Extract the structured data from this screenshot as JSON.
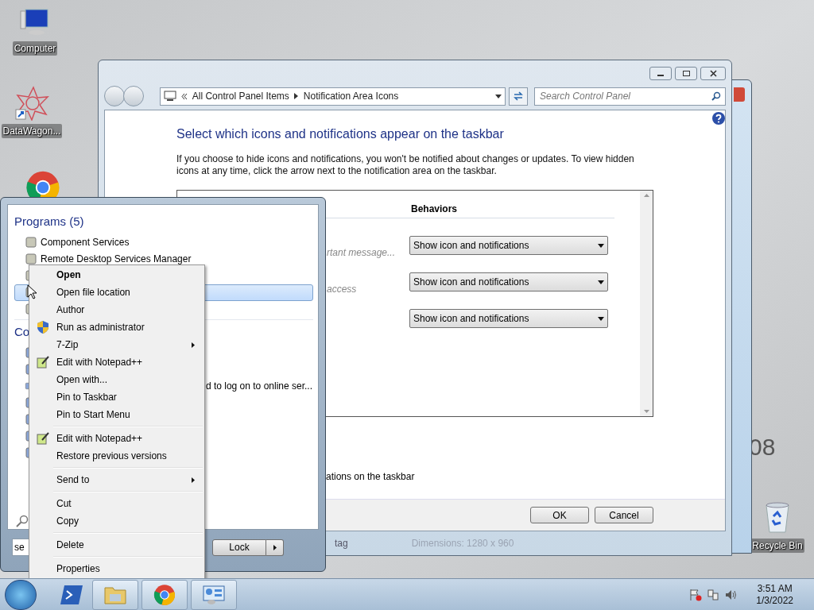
{
  "desktop": {
    "icons": [
      {
        "label": "Computer",
        "kind": "computer"
      },
      {
        "label": "DataWagon...",
        "kind": "shortcut"
      },
      {
        "kind": "browser"
      },
      {
        "label": "Recycle Bin",
        "kind": "recycle"
      }
    ],
    "wallpaper_text": "08"
  },
  "background_window": {
    "texts": [
      "tag",
      "Dimensions: 1280 x 960"
    ]
  },
  "control_panel": {
    "breadcrumb": [
      "All Control Panel Items",
      "Notification Area Icons"
    ],
    "search": {
      "placeholder": "Search Control Panel"
    },
    "heading": "Select which icons and notifications appear on the taskbar",
    "description": "If you choose to hide icons and notifications, you won't be notified about changes or updates. To view hidden icons at any time, click the arrow next to the notification area on the taskbar.",
    "table": {
      "columns": [
        "Behaviors"
      ],
      "rows": [
        {
          "description": "rtant message...",
          "behavior": "Show icon and notifications"
        },
        {
          "description": "access",
          "behavior": "Show icon and notifications"
        },
        {
          "behavior": "Show icon and notifications"
        }
      ]
    },
    "footer_text": "ations on the taskbar",
    "buttons": [
      "OK",
      "Cancel"
    ]
  },
  "start_menu": {
    "sections": [
      {
        "title": "Programs (5)",
        "items": [
          {
            "label": "Component Services",
            "selected": false
          },
          {
            "label": "Remote Desktop Services Manager",
            "selected": false
          },
          {
            "selected": false
          },
          {
            "selected": true
          },
          {
            "selected": false
          }
        ]
      },
      {
        "title": "Co",
        "items": [
          {
            "kind": "item"
          },
          {
            "kind": "item"
          },
          {
            "kind": "item",
            "label": "d to log on to online ser..."
          },
          {
            "kind": "item"
          },
          {
            "kind": "item"
          },
          {
            "kind": "item"
          },
          {
            "kind": "item"
          }
        ]
      }
    ],
    "search": {
      "value": "se"
    },
    "power_button": "Lock"
  },
  "context_menu": {
    "items": [
      {
        "label": "Open",
        "kind": "default"
      },
      {
        "label": "Open file location",
        "kind": "plain"
      },
      {
        "label": "Author",
        "kind": "plain"
      },
      {
        "label": "Run as administrator",
        "kind": "admin"
      },
      {
        "label": "7-Zip",
        "kind": "submenu"
      },
      {
        "label": "Edit with Notepad++",
        "kind": "editor"
      },
      {
        "label": "Open with...",
        "kind": "plain"
      },
      {
        "label": "Pin to Taskbar",
        "kind": "plain"
      },
      {
        "label": "Pin to Start Menu",
        "kind": "plain"
      },
      {
        "kind": "separator"
      },
      {
        "label": "Edit with Notepad++",
        "kind": "editor"
      },
      {
        "label": "Restore previous versions",
        "kind": "plain"
      },
      {
        "kind": "separator"
      },
      {
        "label": "Send to",
        "kind": "submenu"
      },
      {
        "kind": "separator"
      },
      {
        "label": "Cut",
        "kind": "plain"
      },
      {
        "label": "Copy",
        "kind": "plain"
      },
      {
        "kind": "separator"
      },
      {
        "label": "Delete",
        "kind": "plain"
      },
      {
        "kind": "separator"
      },
      {
        "label": "Properties",
        "kind": "plain"
      }
    ]
  },
  "taskbar": {
    "buttons": [
      {
        "kind": "shell",
        "running": false
      },
      {
        "kind": "folder",
        "running": true
      },
      {
        "kind": "browser",
        "running": true
      },
      {
        "kind": "panel",
        "running": true
      }
    ],
    "clock": {
      "time": "3:51 AM",
      "date": "1/3/2022"
    }
  }
}
